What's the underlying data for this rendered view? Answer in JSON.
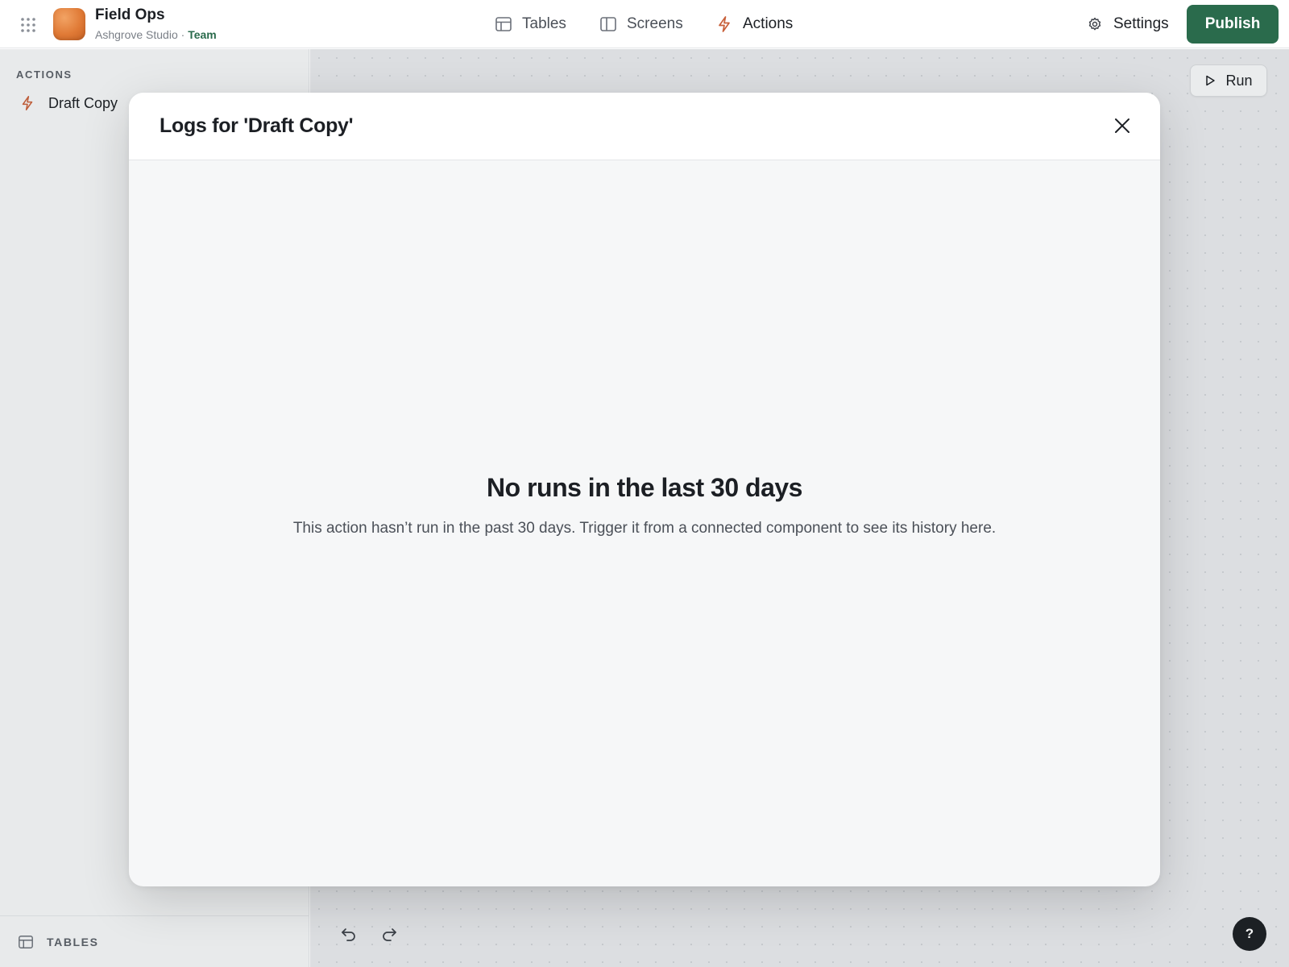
{
  "app": {
    "title": "Field Ops",
    "workspace": "Ashgrove Studio",
    "separator": " · ",
    "plan": "Team",
    "logo_color": "#e07a36"
  },
  "nav": {
    "tabs": [
      {
        "label": "Tables",
        "icon": "table-icon"
      },
      {
        "label": "Screens",
        "icon": "screens-icon"
      },
      {
        "label": "Actions",
        "icon": "lightning-icon",
        "active": true
      }
    ],
    "active_color": "#c8603a"
  },
  "header": {
    "settings_label": "Settings",
    "publish_label": "Publish",
    "publish_color": "#2a6b4c"
  },
  "sidebar": {
    "heading": "ACTIONS",
    "items": [
      {
        "label": "Draft Copy",
        "icon": "lightning-icon"
      }
    ],
    "footer_label": "TABLES"
  },
  "canvas": {
    "run_label": "Run",
    "help_label": "?"
  },
  "modal": {
    "title": "Logs for 'Draft Copy'",
    "empty_title": "No runs in the last 30 days",
    "empty_description": "This action hasn’t run in the past 30 days. Trigger it from a connected component to see its history here."
  }
}
